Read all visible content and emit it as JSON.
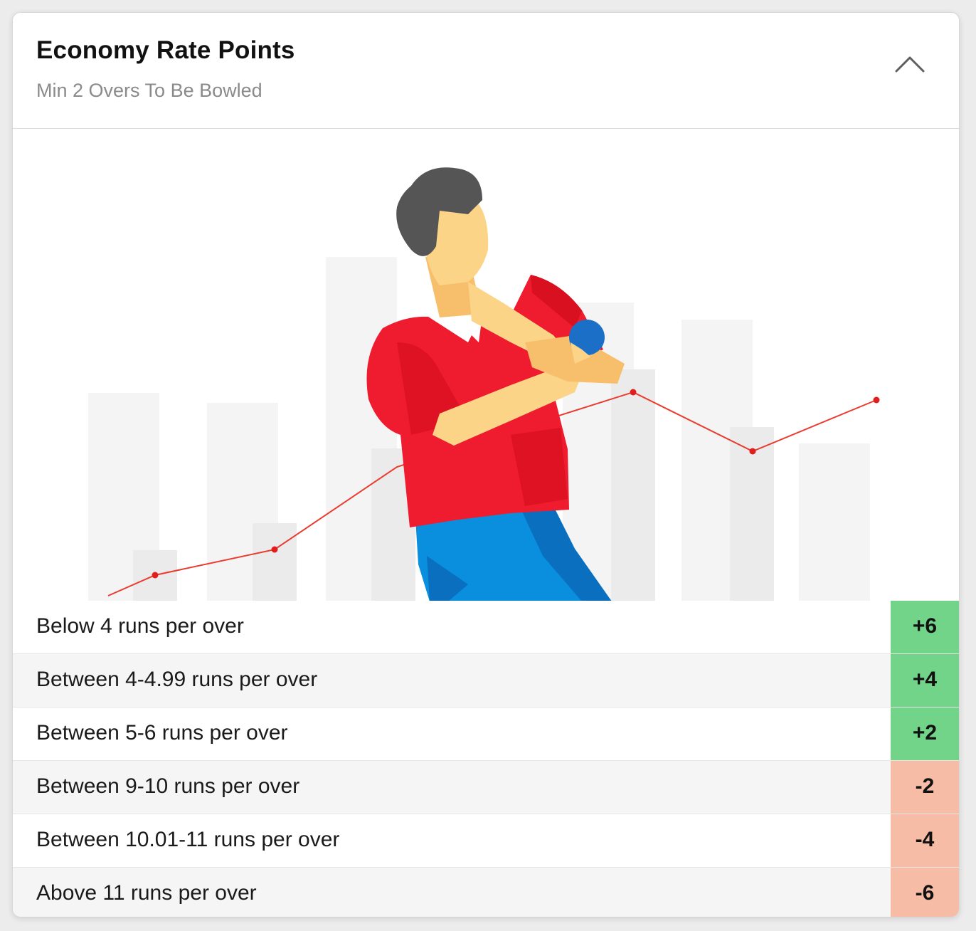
{
  "header": {
    "title": "Economy Rate Points",
    "subtitle": "Min 2 Overs To Be Bowled",
    "collapse_icon": "chevron-up-icon"
  },
  "colors": {
    "positive": "#72d488",
    "negative": "#f7bca6",
    "chart_line": "#ea3b2e",
    "shirt": "#ee1c2e",
    "pants": "#0a8fde",
    "ball": "#1c6fc7"
  },
  "illustration": {
    "icon": "bowler-illustration-icon"
  },
  "rules": [
    {
      "label": "Below 4 runs per over",
      "points": "+6",
      "type": "positive"
    },
    {
      "label": "Between 4-4.99 runs per over",
      "points": "+4",
      "type": "positive"
    },
    {
      "label": "Between 5-6 runs per over",
      "points": "+2",
      "type": "positive"
    },
    {
      "label": "Between 9-10 runs per over",
      "points": "-2",
      "type": "negative"
    },
    {
      "label": "Between 10.01-11 runs per over",
      "points": "-4",
      "type": "negative"
    },
    {
      "label": "Above 11 runs per over",
      "points": "-6",
      "type": "negative"
    }
  ]
}
